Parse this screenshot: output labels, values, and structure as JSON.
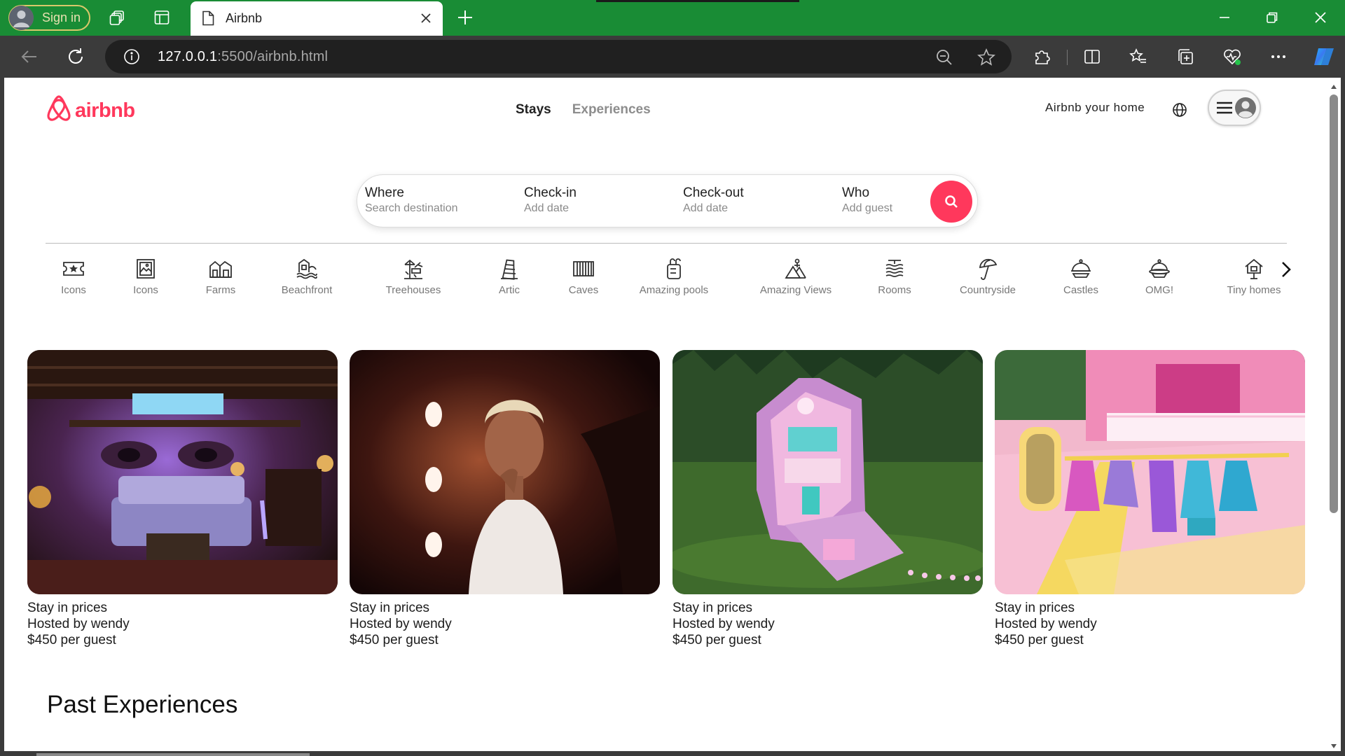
{
  "browser": {
    "signin_label": "Sign in",
    "tab_title": "Airbnb",
    "url_host": "127.0.0.1",
    "url_rest": ":5500/airbnb.html"
  },
  "header": {
    "logo_text": "airbnb",
    "tabs": [
      {
        "label": "Stays",
        "active": true
      },
      {
        "label": "Experiences",
        "active": false
      }
    ],
    "host_link": "Airbnb your home"
  },
  "search": {
    "fields": [
      {
        "label": "Where",
        "placeholder": "Search destination"
      },
      {
        "label": "Check-in",
        "placeholder": "Add date"
      },
      {
        "label": "Check-out",
        "placeholder": "Add date"
      },
      {
        "label": "Who",
        "placeholder": "Add guest"
      }
    ]
  },
  "categories": [
    {
      "label": "Icons",
      "icon": "star-ticket-icon"
    },
    {
      "label": "Icons",
      "icon": "framed-picture-icon"
    },
    {
      "label": "Farms",
      "icon": "barn-icon"
    },
    {
      "label": "Beachfront",
      "icon": "beach-house-icon"
    },
    {
      "label": "Treehouses",
      "icon": "treehouse-icon"
    },
    {
      "label": "Artic",
      "icon": "tower-icon"
    },
    {
      "label": "Caves",
      "icon": "grill-icon"
    },
    {
      "label": "Amazing pools",
      "icon": "pool-ladder-icon"
    },
    {
      "label": "Amazing Views",
      "icon": "mountain-view-icon"
    },
    {
      "label": "Rooms",
      "icon": "stacked-rooms-icon"
    },
    {
      "label": "Countryside",
      "icon": "umbrella-icon"
    },
    {
      "label": "Castles",
      "icon": "castle-dome-icon"
    },
    {
      "label": "OMG!",
      "icon": "ufo-icon"
    },
    {
      "label": "Tiny homes",
      "icon": "tiny-home-icon"
    }
  ],
  "listings": [
    {
      "title": "Stay in prices",
      "host": "Hosted by wendy",
      "price": "$450 per guest",
      "image": "purple-bedroom"
    },
    {
      "title": "Stay in prices",
      "host": "Hosted by wendy",
      "price": "$450 per guest",
      "image": "portrait-mirror"
    },
    {
      "title": "Stay in prices",
      "host": "Hosted by wendy",
      "price": "$450 per guest",
      "image": "polly-pocket-house"
    },
    {
      "title": "Stay in prices",
      "host": "Hosted by wendy",
      "price": "$450 per guest",
      "image": "barbie-closet"
    }
  ],
  "past_section_title": "Past Experiences",
  "colors": {
    "brand": "#ff385c",
    "titlebar": "#198c35",
    "toolbar": "#3b3b3b"
  }
}
